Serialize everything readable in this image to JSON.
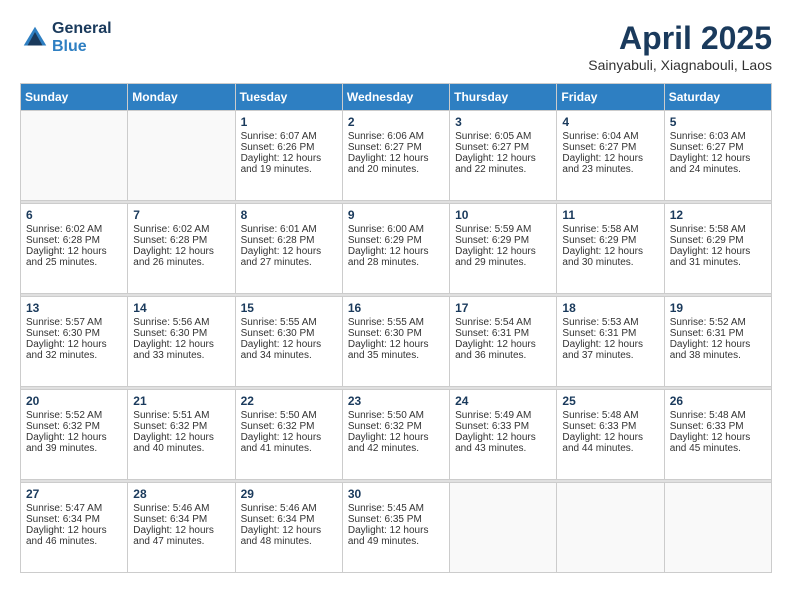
{
  "header": {
    "logo_line1": "General",
    "logo_line2": "Blue",
    "month": "April 2025",
    "location": "Sainyabuli, Xiagnabouli, Laos"
  },
  "days_of_week": [
    "Sunday",
    "Monday",
    "Tuesday",
    "Wednesday",
    "Thursday",
    "Friday",
    "Saturday"
  ],
  "weeks": [
    [
      {
        "day": "",
        "sunrise": "",
        "sunset": "",
        "daylight": ""
      },
      {
        "day": "",
        "sunrise": "",
        "sunset": "",
        "daylight": ""
      },
      {
        "day": "1",
        "sunrise": "Sunrise: 6:07 AM",
        "sunset": "Sunset: 6:26 PM",
        "daylight": "Daylight: 12 hours and 19 minutes."
      },
      {
        "day": "2",
        "sunrise": "Sunrise: 6:06 AM",
        "sunset": "Sunset: 6:27 PM",
        "daylight": "Daylight: 12 hours and 20 minutes."
      },
      {
        "day": "3",
        "sunrise": "Sunrise: 6:05 AM",
        "sunset": "Sunset: 6:27 PM",
        "daylight": "Daylight: 12 hours and 22 minutes."
      },
      {
        "day": "4",
        "sunrise": "Sunrise: 6:04 AM",
        "sunset": "Sunset: 6:27 PM",
        "daylight": "Daylight: 12 hours and 23 minutes."
      },
      {
        "day": "5",
        "sunrise": "Sunrise: 6:03 AM",
        "sunset": "Sunset: 6:27 PM",
        "daylight": "Daylight: 12 hours and 24 minutes."
      }
    ],
    [
      {
        "day": "6",
        "sunrise": "Sunrise: 6:02 AM",
        "sunset": "Sunset: 6:28 PM",
        "daylight": "Daylight: 12 hours and 25 minutes."
      },
      {
        "day": "7",
        "sunrise": "Sunrise: 6:02 AM",
        "sunset": "Sunset: 6:28 PM",
        "daylight": "Daylight: 12 hours and 26 minutes."
      },
      {
        "day": "8",
        "sunrise": "Sunrise: 6:01 AM",
        "sunset": "Sunset: 6:28 PM",
        "daylight": "Daylight: 12 hours and 27 minutes."
      },
      {
        "day": "9",
        "sunrise": "Sunrise: 6:00 AM",
        "sunset": "Sunset: 6:29 PM",
        "daylight": "Daylight: 12 hours and 28 minutes."
      },
      {
        "day": "10",
        "sunrise": "Sunrise: 5:59 AM",
        "sunset": "Sunset: 6:29 PM",
        "daylight": "Daylight: 12 hours and 29 minutes."
      },
      {
        "day": "11",
        "sunrise": "Sunrise: 5:58 AM",
        "sunset": "Sunset: 6:29 PM",
        "daylight": "Daylight: 12 hours and 30 minutes."
      },
      {
        "day": "12",
        "sunrise": "Sunrise: 5:58 AM",
        "sunset": "Sunset: 6:29 PM",
        "daylight": "Daylight: 12 hours and 31 minutes."
      }
    ],
    [
      {
        "day": "13",
        "sunrise": "Sunrise: 5:57 AM",
        "sunset": "Sunset: 6:30 PM",
        "daylight": "Daylight: 12 hours and 32 minutes."
      },
      {
        "day": "14",
        "sunrise": "Sunrise: 5:56 AM",
        "sunset": "Sunset: 6:30 PM",
        "daylight": "Daylight: 12 hours and 33 minutes."
      },
      {
        "day": "15",
        "sunrise": "Sunrise: 5:55 AM",
        "sunset": "Sunset: 6:30 PM",
        "daylight": "Daylight: 12 hours and 34 minutes."
      },
      {
        "day": "16",
        "sunrise": "Sunrise: 5:55 AM",
        "sunset": "Sunset: 6:30 PM",
        "daylight": "Daylight: 12 hours and 35 minutes."
      },
      {
        "day": "17",
        "sunrise": "Sunrise: 5:54 AM",
        "sunset": "Sunset: 6:31 PM",
        "daylight": "Daylight: 12 hours and 36 minutes."
      },
      {
        "day": "18",
        "sunrise": "Sunrise: 5:53 AM",
        "sunset": "Sunset: 6:31 PM",
        "daylight": "Daylight: 12 hours and 37 minutes."
      },
      {
        "day": "19",
        "sunrise": "Sunrise: 5:52 AM",
        "sunset": "Sunset: 6:31 PM",
        "daylight": "Daylight: 12 hours and 38 minutes."
      }
    ],
    [
      {
        "day": "20",
        "sunrise": "Sunrise: 5:52 AM",
        "sunset": "Sunset: 6:32 PM",
        "daylight": "Daylight: 12 hours and 39 minutes."
      },
      {
        "day": "21",
        "sunrise": "Sunrise: 5:51 AM",
        "sunset": "Sunset: 6:32 PM",
        "daylight": "Daylight: 12 hours and 40 minutes."
      },
      {
        "day": "22",
        "sunrise": "Sunrise: 5:50 AM",
        "sunset": "Sunset: 6:32 PM",
        "daylight": "Daylight: 12 hours and 41 minutes."
      },
      {
        "day": "23",
        "sunrise": "Sunrise: 5:50 AM",
        "sunset": "Sunset: 6:32 PM",
        "daylight": "Daylight: 12 hours and 42 minutes."
      },
      {
        "day": "24",
        "sunrise": "Sunrise: 5:49 AM",
        "sunset": "Sunset: 6:33 PM",
        "daylight": "Daylight: 12 hours and 43 minutes."
      },
      {
        "day": "25",
        "sunrise": "Sunrise: 5:48 AM",
        "sunset": "Sunset: 6:33 PM",
        "daylight": "Daylight: 12 hours and 44 minutes."
      },
      {
        "day": "26",
        "sunrise": "Sunrise: 5:48 AM",
        "sunset": "Sunset: 6:33 PM",
        "daylight": "Daylight: 12 hours and 45 minutes."
      }
    ],
    [
      {
        "day": "27",
        "sunrise": "Sunrise: 5:47 AM",
        "sunset": "Sunset: 6:34 PM",
        "daylight": "Daylight: 12 hours and 46 minutes."
      },
      {
        "day": "28",
        "sunrise": "Sunrise: 5:46 AM",
        "sunset": "Sunset: 6:34 PM",
        "daylight": "Daylight: 12 hours and 47 minutes."
      },
      {
        "day": "29",
        "sunrise": "Sunrise: 5:46 AM",
        "sunset": "Sunset: 6:34 PM",
        "daylight": "Daylight: 12 hours and 48 minutes."
      },
      {
        "day": "30",
        "sunrise": "Sunrise: 5:45 AM",
        "sunset": "Sunset: 6:35 PM",
        "daylight": "Daylight: 12 hours and 49 minutes."
      },
      {
        "day": "",
        "sunrise": "",
        "sunset": "",
        "daylight": ""
      },
      {
        "day": "",
        "sunrise": "",
        "sunset": "",
        "daylight": ""
      },
      {
        "day": "",
        "sunrise": "",
        "sunset": "",
        "daylight": ""
      }
    ]
  ]
}
